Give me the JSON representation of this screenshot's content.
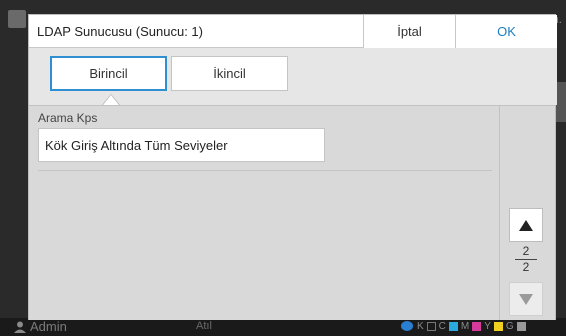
{
  "background": {
    "corner_text": "n.",
    "user_name": "Admin",
    "status_text": "Atıl",
    "ink_levels": [
      {
        "label": "K",
        "color": "#1a1a1a"
      },
      {
        "label": "C",
        "color": "#2aa8e0"
      },
      {
        "label": "M",
        "color": "#d63a9c"
      },
      {
        "label": "Y",
        "color": "#f0d020"
      },
      {
        "label": "G",
        "color": "#9a9a9a"
      }
    ]
  },
  "dialog": {
    "title": "LDAP Sunucusu (Sunucu: 1)",
    "cancel_label": "İptal",
    "ok_label": "OK",
    "tabs": [
      {
        "label": "Birincil",
        "selected": true
      },
      {
        "label": "İkincil",
        "selected": false
      }
    ],
    "field": {
      "label": "Arama Kps",
      "value": "Kök Giriş Altında Tüm Seviyeler"
    },
    "pager": {
      "current": "2",
      "total": "2"
    }
  },
  "colors": {
    "accent": "#2f8fd0",
    "ok_text": "#1a7fc1"
  }
}
